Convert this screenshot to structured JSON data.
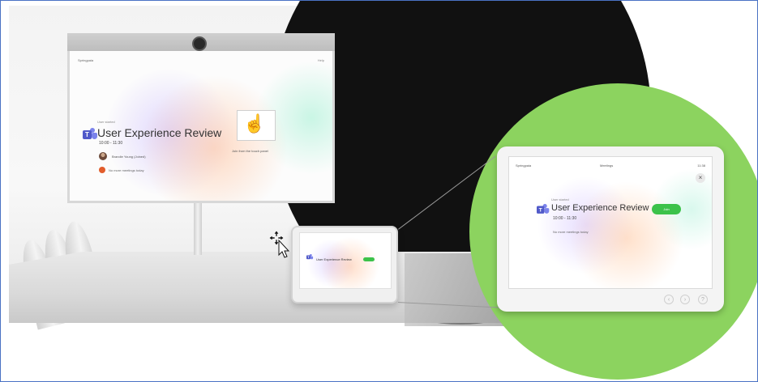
{
  "colors": {
    "frame_border": "#4a72c4",
    "magnifier_bg": "#8cd35f",
    "join_button": "#3cc24a",
    "teams_purple": "#5059c9"
  },
  "main_screen": {
    "brand": "Springpaia",
    "help": "Help",
    "host_label": "User started",
    "title": "User Experience Review",
    "time_range": "10:00 - 11:30",
    "organizer": "Brandie Young (Joined)",
    "no_more": "No more meetings today",
    "join_hint": "Join from the touch panel",
    "icons": [
      "teams-icon",
      "touch-hand-icon"
    ]
  },
  "table_panel": {
    "title": "User Experience Review"
  },
  "touch_panel_zoom": {
    "brand": "Springpaia",
    "header": "Meetings",
    "clock": "11:38",
    "host_label": "User started",
    "title": "User Experience Review",
    "time_range": "10:00 - 11:30",
    "no_more": "No more meetings today",
    "join_label": "Join",
    "controls": [
      "back-icon",
      "forward-icon",
      "help-icon"
    ]
  }
}
